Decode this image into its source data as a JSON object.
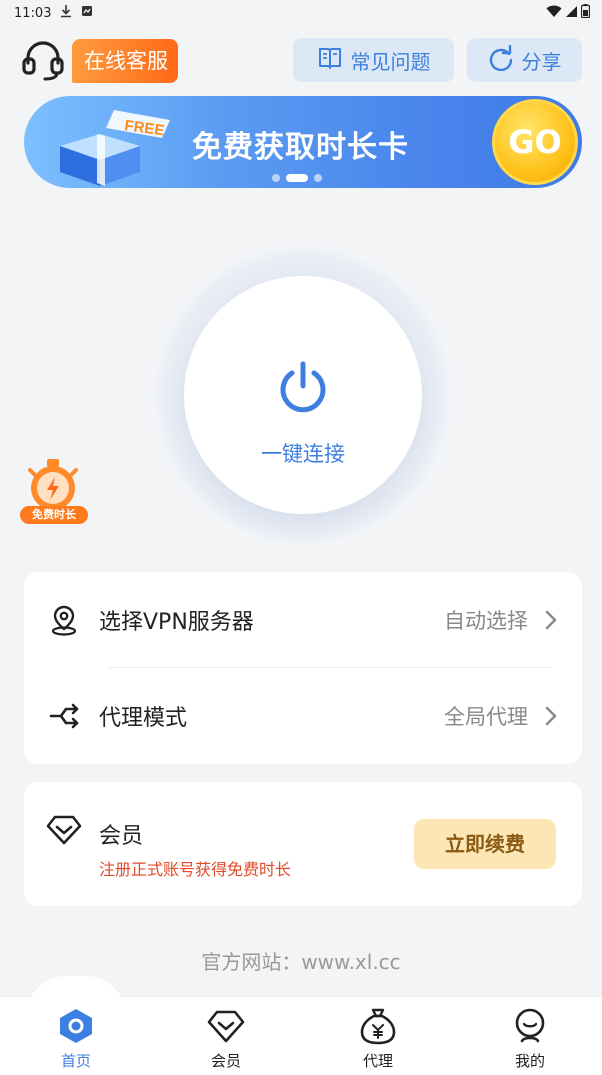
{
  "status_bar": {
    "time": "11:03"
  },
  "header": {
    "customer_service": "在线客服",
    "faq": "常见问题",
    "share": "分享"
  },
  "banner": {
    "tag": "FREE",
    "title": "免费获取时长卡",
    "go_label": "GO"
  },
  "connect": {
    "label": "一键连接"
  },
  "free_time": {
    "label": "免费时长"
  },
  "settings": {
    "items": [
      {
        "label": "选择VPN服务器",
        "value": "自动选择",
        "icon": "location-pin-icon"
      },
      {
        "label": "代理模式",
        "value": "全局代理",
        "icon": "route-switch-icon"
      }
    ]
  },
  "member": {
    "title": "会员",
    "subtitle": "注册正式账号获得免费时长",
    "button": "立即续费"
  },
  "website": "官方网站：www.xl.cc",
  "bottom_nav": [
    {
      "label": "首页",
      "icon": "home-icon",
      "active": true
    },
    {
      "label": "会员",
      "icon": "diamond-icon",
      "active": false
    },
    {
      "label": "代理",
      "icon": "money-bag-icon",
      "active": false
    },
    {
      "label": "我的",
      "icon": "profile-icon",
      "active": false
    }
  ],
  "colors": {
    "accent": "#3d7fe0",
    "orange": "#ff7a1c",
    "warning_text": "#e24a2a"
  }
}
